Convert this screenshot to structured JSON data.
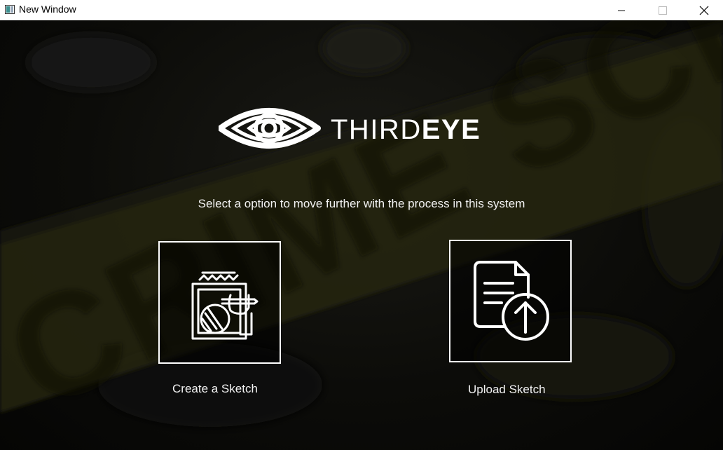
{
  "window": {
    "title": "New Window",
    "controls": {
      "minimize": "—",
      "maximize": "☐",
      "close": "✕"
    }
  },
  "brand": {
    "name_thin": "THIRD",
    "name_bold": "EYE",
    "logo_icon": "eye-logo-icon"
  },
  "background": {
    "watermark": "CRIME SCENE DO NOT"
  },
  "main": {
    "subtitle": "Select a option to move further with the process in this system",
    "options": [
      {
        "label": "Create a Sketch",
        "icon": "sketch-drawing-icon"
      },
      {
        "label": "Upload Sketch",
        "icon": "document-upload-icon"
      }
    ]
  }
}
